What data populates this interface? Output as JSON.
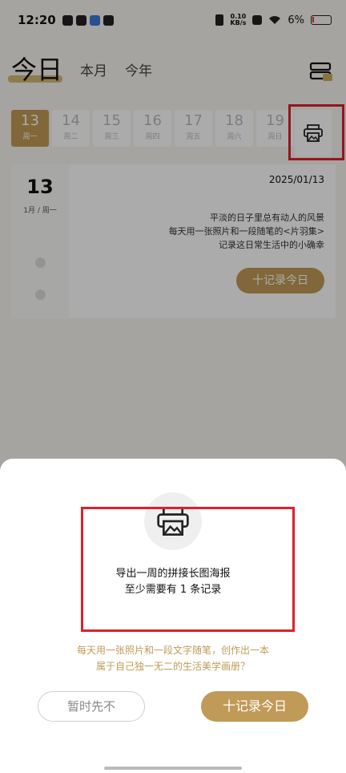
{
  "status_bar": {
    "time": "12:20",
    "net_speed_value": "0.10",
    "net_speed_unit": "KB/s",
    "battery": "6%"
  },
  "header": {
    "title": "今日",
    "tab_month": "本月",
    "tab_year": "今年"
  },
  "week": [
    {
      "num": "13",
      "wk": "周一",
      "active": true
    },
    {
      "num": "14",
      "wk": "周二"
    },
    {
      "num": "15",
      "wk": "周三"
    },
    {
      "num": "16",
      "wk": "周四"
    },
    {
      "num": "17",
      "wk": "周五"
    },
    {
      "num": "18",
      "wk": "周六"
    },
    {
      "num": "19",
      "wk": "周日"
    }
  ],
  "card": {
    "day": "13",
    "sub": "1月 / 周一",
    "date": "2025/01/13",
    "text_lines": [
      "平淡的日子里总有动人的风景",
      "每天用一张照片和一段随笔的<片羽集>",
      "记录这日常生活中的小确幸"
    ],
    "record_button": "十记录今日"
  },
  "sheet": {
    "line1": "导出一周的拼接长图海报",
    "line2": "至少需要有 1 条记录",
    "promo_line1": "每天用一张照片和一段文字随笔，创作出一本",
    "promo_line2": "属于自己独一无二的生活美学画册？",
    "later_button": "暂时先不",
    "record_button": "十记录今日"
  },
  "colors": {
    "accent": "#c09a57",
    "highlight_box": "#e0202a"
  }
}
